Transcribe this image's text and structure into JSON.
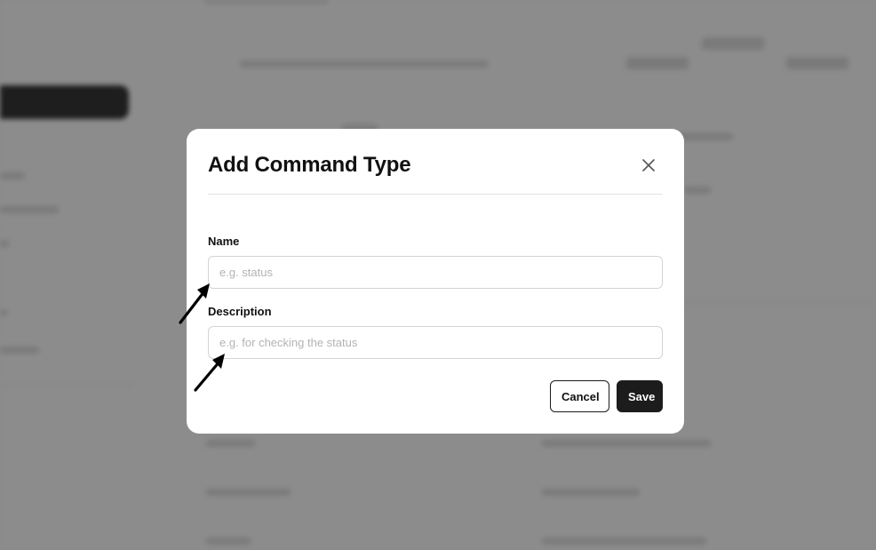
{
  "modal": {
    "title": "Add Command Type",
    "close_icon": "close-icon",
    "fields": {
      "name": {
        "label": "Name",
        "placeholder": "e.g. status",
        "value": ""
      },
      "description": {
        "label": "Description",
        "placeholder": "e.g. for checking the status",
        "value": ""
      }
    },
    "actions": {
      "cancel_label": "Cancel",
      "save_label": "Save"
    }
  },
  "annotations": {
    "arrow_icon": "arrow-pointer-icon"
  },
  "colors": {
    "backdrop": "#8c8c8c",
    "primary_button": "#1c1c1c",
    "modal_bg": "#ffffff"
  }
}
